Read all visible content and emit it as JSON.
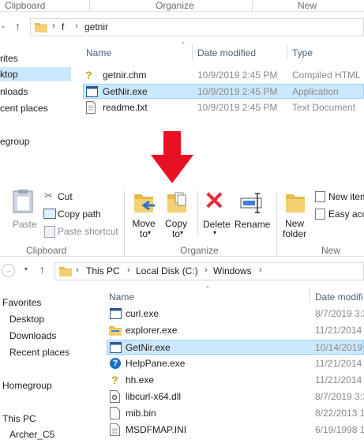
{
  "top": {
    "ribbon_groups": [
      "Clipboard",
      "Organize",
      "New"
    ],
    "address": {
      "crumbs": [
        "f",
        "getnir"
      ]
    },
    "columns": [
      "Name",
      "Date modified",
      "Type"
    ],
    "nav": [
      "rites",
      "ktop",
      "nloads",
      "cent places",
      "egroup"
    ],
    "files": [
      {
        "name": "getnir.chm",
        "date": "10/9/2019 2:45 PM",
        "type": "Compiled HTML"
      },
      {
        "name": "GetNir.exe",
        "date": "10/9/2019 2:45 PM",
        "type": "Application"
      },
      {
        "name": "readme.txt",
        "date": "10/9/2019 2:45 PM",
        "type": "Text Document"
      }
    ]
  },
  "bottom": {
    "ribbon": {
      "paste": "Paste",
      "cut": "Cut",
      "copy_path": "Copy path",
      "paste_shortcut": "Paste shortcut",
      "move_to": "Move to",
      "copy_to": "Copy to",
      "delete": "Delete",
      "rename": "Rename",
      "new_folder": "New folder",
      "new_item": "New item",
      "easy_access": "Easy acce",
      "groups": [
        "Clipboard",
        "Organize",
        "New"
      ]
    },
    "address": {
      "crumbs": [
        "This PC",
        "Local Disk (C:)",
        "Windows"
      ]
    },
    "columns": [
      "Name",
      "Date modifi"
    ],
    "nav": [
      "Favorites",
      "Desktop",
      "Downloads",
      "Recent places",
      "Homegroup",
      "This PC",
      "Archer_C5"
    ],
    "files": [
      {
        "name": "curl.exe",
        "date": "8/7/2019 3:3"
      },
      {
        "name": "explorer.exe",
        "date": "11/21/2014"
      },
      {
        "name": "GetNir.exe",
        "date": "10/14/2019"
      },
      {
        "name": "HelpPane.exe",
        "date": "11/21/2014"
      },
      {
        "name": "hh.exe",
        "date": "11/21/2014"
      },
      {
        "name": "libcurl-x64.dll",
        "date": "8/7/2019 3:3"
      },
      {
        "name": "mib.bin",
        "date": "8/22/2013 1"
      },
      {
        "name": "MSDFMAP.INI",
        "date": "6/19/1998 1"
      }
    ]
  },
  "colors": {
    "selection": "#cce8ff",
    "arrow": "#e81123",
    "folder": "#e8b84a"
  }
}
